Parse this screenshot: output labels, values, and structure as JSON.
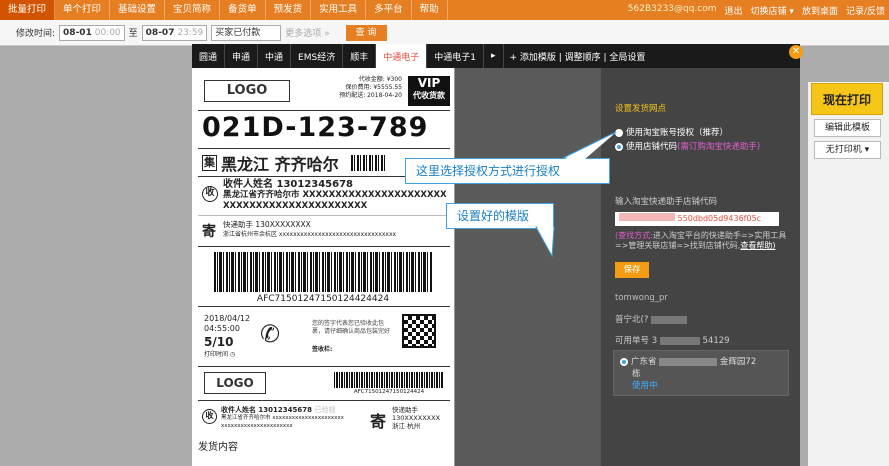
{
  "topnav": {
    "items": [
      "批量打印",
      "单个打印",
      "基础设置",
      "宝贝简称",
      "备货单",
      "预发货",
      "实用工具",
      "多平台",
      "帮助"
    ],
    "email": "562B3233@qq.com",
    "links": [
      "退出",
      "切换店铺 ▾",
      "放到桌面",
      "记录/反馈"
    ]
  },
  "filter": {
    "label": "修改时间:",
    "date_from": "08-01",
    "time_from": "00:00",
    "to": "至",
    "date_to": "08-07",
    "time_to": "23:59",
    "status": "买家已付款",
    "more": "更多选项 »",
    "query": "查 询"
  },
  "tabs": {
    "items": [
      "圆通",
      "申通",
      "中通",
      "EMS经济",
      "顺丰",
      "中通电子",
      "中通电子1",
      "▸"
    ],
    "active_index": 5,
    "links": "+ 添加模版 | 调整顺序 | 全局设置"
  },
  "close_icon": "close-icon",
  "label": {
    "logo": "LOGO",
    "fee_lines": [
      "代收金额: ¥300",
      "保价费用: ¥5555.55",
      "预约配送: 2018-04-20"
    ],
    "vip_line1": "VIP",
    "vip_line2": "代收货款",
    "big_number": "021D-123-789",
    "dest_icon": "集",
    "dest_text": "黑龙江 齐齐哈尔",
    "recv_icon": "收",
    "recv_name": "收件人姓名  13012345678",
    "recv_addr": "黑龙江省齐齐哈尔市 XXXXXXXXXXXXXXXXXXXXXX",
    "recv_addr2": "XXXXXXXXXXXXXXXXXXXXXX",
    "send_icon": "寄",
    "send_name": "快递助手    130XXXXXXXX",
    "send_addr": "浙江省杭州市余杭区 xxxxxxxxxxxxxxxxxxxxxxxxxxxxxxxxx",
    "barcode_text": "AFC71501247150124424424",
    "print_date": "2018/04/12",
    "print_time": "04:55:00",
    "piece": "5/10",
    "print_label": "打印时间",
    "notice": "您的签字代表您已验收此包裹，请仔细确认商品包装完好",
    "sign": "签收栏:",
    "logo2": "LOGO",
    "barcode_text2": "AFC71501247150124424",
    "recv_name2": "收件人姓名  13012345678",
    "signed": "已验视",
    "recv_addr_b": "黑龙江省齐齐哈尔市 xxxxxxxxxxxxxxxxxxxxxx",
    "recv_addr_b2": "xxxxxxxxxxxxxxxxxxxxxx",
    "send_name2": "快递助手",
    "send_tel2": "130XXXXXXXX",
    "send_city2": "浙江 杭州",
    "content": "发货内容"
  },
  "callouts": {
    "auth": "这里选择授权方式进行授权",
    "template": "设置好的模版"
  },
  "settings": {
    "title": "设置发货网点",
    "opt1": "使用淘宝账号授权（推荐）",
    "opt2": "使用店铺代码",
    "opt2_link": "(需订购淘宝快递助手)",
    "input_label": "输入淘宝快递助手店铺代码",
    "code_value": "550dbd05d9436f05c",
    "hint_prefix": "(查找方式:",
    "hint_body": "进入淘宝平台的快递助手=>实用工具=>管理关联店铺=>找到店铺代码,",
    "hint_link": "查看帮助)",
    "save": "保存",
    "account": "tomwong_pr",
    "branch": "普宁北(?",
    "available": "可用单号 3",
    "available_num": "54129",
    "net_prefix": "广东省",
    "net_suffix": "金辉园72",
    "net_suffix2": "栋",
    "in_use": "使用中"
  },
  "right_buttons": {
    "print": "现在打印",
    "edit": "编辑此模板",
    "printer": "无打印机 ▾"
  },
  "colors": {
    "orange": "#e67e22",
    "blue_callout": "#3da0e0"
  }
}
